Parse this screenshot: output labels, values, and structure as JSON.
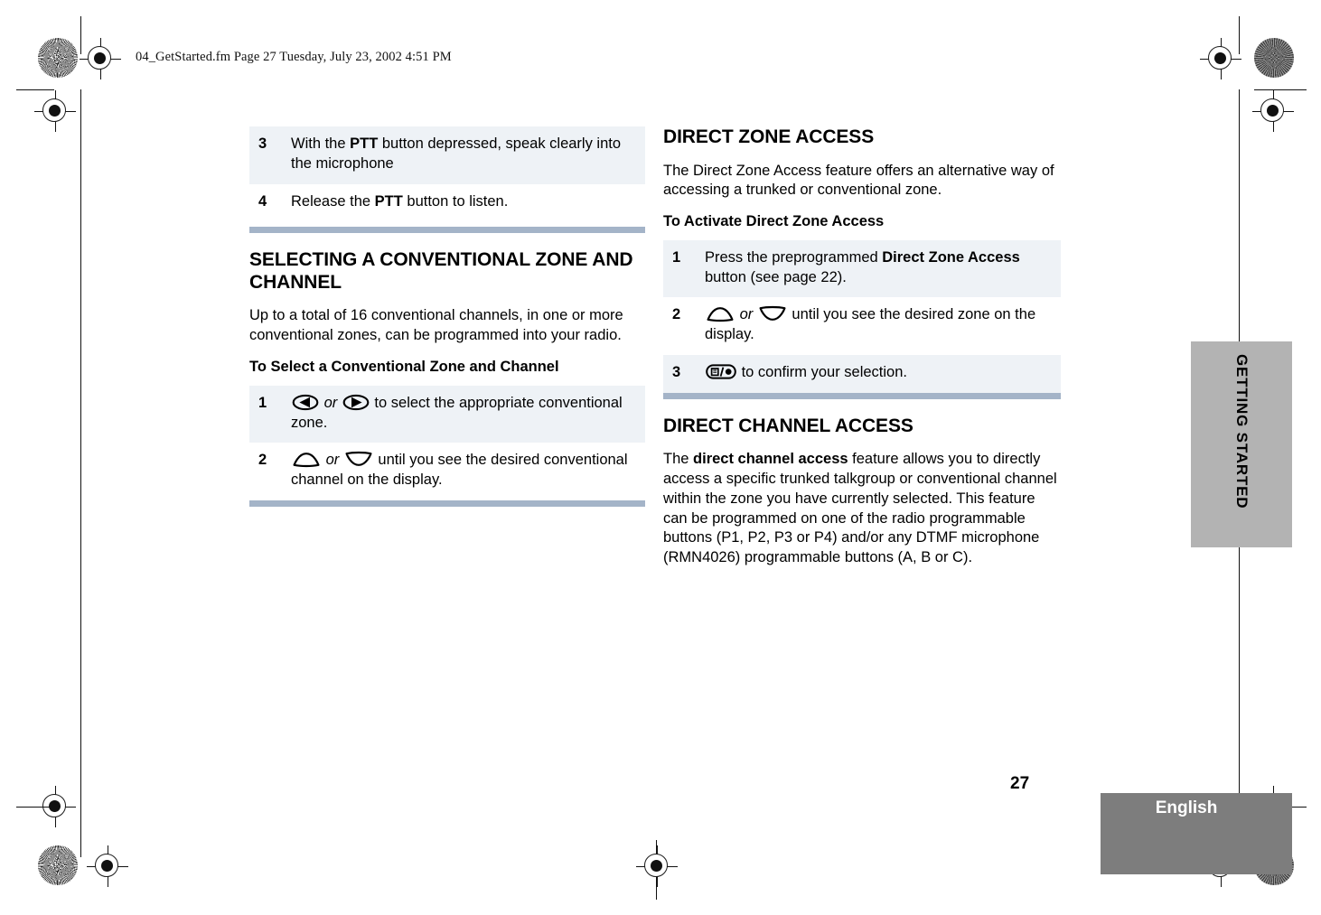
{
  "header": {
    "file_stamp": "04_GetStarted.fm  Page 27  Tuesday, July 23, 2002  4:51 PM"
  },
  "side_tab": {
    "label": "GETTING STARTED"
  },
  "footer": {
    "page_number": "27",
    "language": "English"
  },
  "colors": {
    "step_row_shade": "#eef2f6",
    "rule_blue": "#a4b4c8",
    "side_tab_gray": "#b3b3b3",
    "footer_gray": "#7d7d7d"
  },
  "left_column": {
    "continued_steps": [
      {
        "number": "3",
        "shaded": true,
        "parts": [
          {
            "type": "text",
            "value": "With the "
          },
          {
            "type": "bold",
            "value": "PTT"
          },
          {
            "type": "text",
            "value": " button depressed, speak clearly into the microphone"
          }
        ]
      },
      {
        "number": "4",
        "shaded": false,
        "parts": [
          {
            "type": "text",
            "value": "Release the "
          },
          {
            "type": "bold",
            "value": "PTT"
          },
          {
            "type": "text",
            "value": " button to listen."
          }
        ]
      }
    ],
    "section_title": "SELECTING A CONVENTIONAL ZONE AND CHANNEL",
    "intro_paragraph": "Up to a total of 16 conventional channels, in one or more conventional zones, can be programmed into your radio.",
    "sub_title": "To Select a Conventional Zone and Channel",
    "steps": [
      {
        "number": "1",
        "shaded": true,
        "parts": [
          {
            "type": "icon",
            "value": "left-arrow-button-icon"
          },
          {
            "type": "italic",
            "value": " or "
          },
          {
            "type": "icon",
            "value": "right-arrow-button-icon"
          },
          {
            "type": "text",
            "value": " to select the appropriate conventional zone."
          }
        ]
      },
      {
        "number": "2",
        "shaded": false,
        "parts": [
          {
            "type": "icon",
            "value": "up-arrow-button-icon"
          },
          {
            "type": "italic",
            "value": " or "
          },
          {
            "type": "icon",
            "value": "down-arrow-button-icon"
          },
          {
            "type": "text",
            "value": " until you see the desired conventional channel on the display."
          }
        ]
      }
    ]
  },
  "right_column": {
    "zone_access": {
      "section_title": "DIRECT ZONE ACCESS",
      "intro_paragraph": "The Direct Zone Access feature offers an alternative way of accessing a trunked or conventional zone.",
      "sub_title": "To Activate Direct Zone Access",
      "steps": [
        {
          "number": "1",
          "shaded": true,
          "parts": [
            {
              "type": "text",
              "value": "Press the preprogrammed "
            },
            {
              "type": "bold",
              "value": "Direct Zone Access"
            },
            {
              "type": "text",
              "value": " button (see page 22)."
            }
          ]
        },
        {
          "number": "2",
          "shaded": false,
          "parts": [
            {
              "type": "icon",
              "value": "up-arrow-button-icon"
            },
            {
              "type": "italic",
              "value": " or "
            },
            {
              "type": "icon",
              "value": "down-arrow-button-icon"
            },
            {
              "type": "text",
              "value": " until you see the desired zone on the display."
            }
          ]
        },
        {
          "number": "3",
          "shaded": true,
          "parts": [
            {
              "type": "icon",
              "value": "menu-select-button-icon"
            },
            {
              "type": "text",
              "value": " to confirm your selection."
            }
          ]
        }
      ]
    },
    "channel_access": {
      "section_title": "DIRECT CHANNEL ACCESS",
      "paragraph_parts": [
        {
          "type": "text",
          "value": "The "
        },
        {
          "type": "bold",
          "value": "direct channel access"
        },
        {
          "type": "text",
          "value": " feature allows you to directly access a specific trunked talkgroup or conventional channel within the zone you have currently selected. This feature can be programmed on one of the radio programmable buttons (P1, P2, P3 or P4) and/or any DTMF microphone (RMN4026) programmable buttons (A, B or C)."
        }
      ]
    }
  }
}
